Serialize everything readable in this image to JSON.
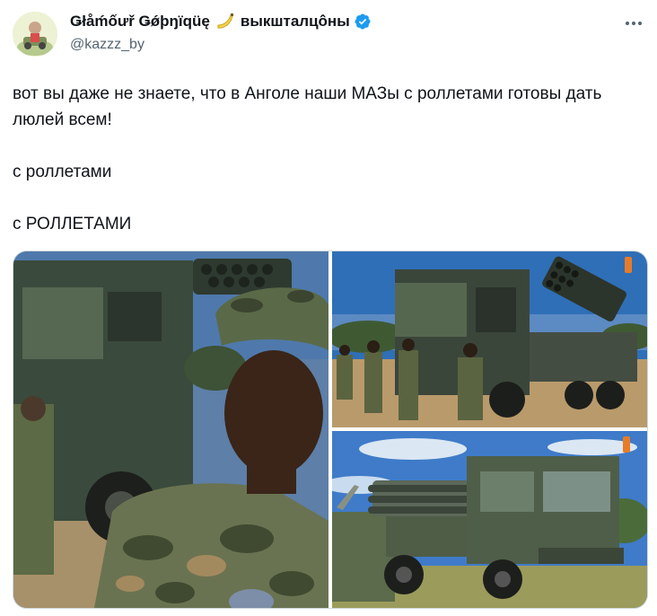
{
  "author": {
    "display_name": "Ǥłåḿốưř Ǥǿþŋïqüę",
    "emoji": "banana-emoji",
    "suffix": "выкшталцôны",
    "verified": true,
    "handle": "@kazzz_by"
  },
  "tweet": {
    "lines": [
      "вот вы даже не знаете, что в Анголе наши МАЗы с роллетами готовы дать люлей всем!",
      "",
      "с роллетами",
      "",
      "с РОЛЛЕТАМИ"
    ]
  },
  "media": {
    "images": [
      {
        "name": "soldier-interview-photo",
        "subject": "soldier-in-camouflage-in-front-of-rocket-truck"
      },
      {
        "name": "rocket-launcher-with-soldiers-photo",
        "subject": "maz-rocket-launcher-with-troops"
      },
      {
        "name": "rocket-launcher-field-photo",
        "subject": "maz-rocket-launcher-in-grass-field"
      }
    ]
  },
  "colors": {
    "text": "#0f1419",
    "secondary": "#536471",
    "verified": "#1d9bf0",
    "border": "#cfd9de"
  },
  "icons": {
    "more": "more-dots-icon",
    "verified": "verified-badge-icon"
  }
}
